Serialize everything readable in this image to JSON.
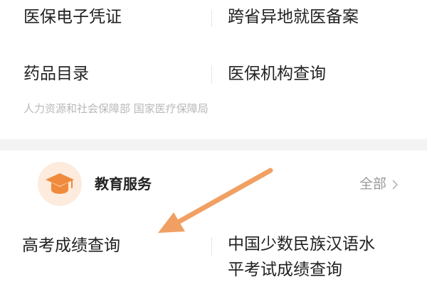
{
  "medical_services": {
    "items": [
      {
        "label": "医保电子凭证"
      },
      {
        "label": "跨省异地就医备案"
      },
      {
        "label": "药品目录"
      },
      {
        "label": "医保机构查询"
      }
    ],
    "source_note": "人力资源和社会保障部 国家医疗保障局"
  },
  "education_services": {
    "icon": "graduation-cap-icon",
    "title": "教育服务",
    "see_all_label": "全部",
    "items": [
      {
        "label": "高考成绩查询"
      },
      {
        "label_line1": "中国少数民族汉语水",
        "label_line2": "平考试成绩查询"
      }
    ]
  },
  "colors": {
    "accent_orange": "#f08a3c",
    "icon_bg": "#fdebdd",
    "arrow": "#f1a064",
    "page_bg": "#f3f3f3",
    "secondary_text": "#999999",
    "source_text": "#b8b8b8"
  }
}
